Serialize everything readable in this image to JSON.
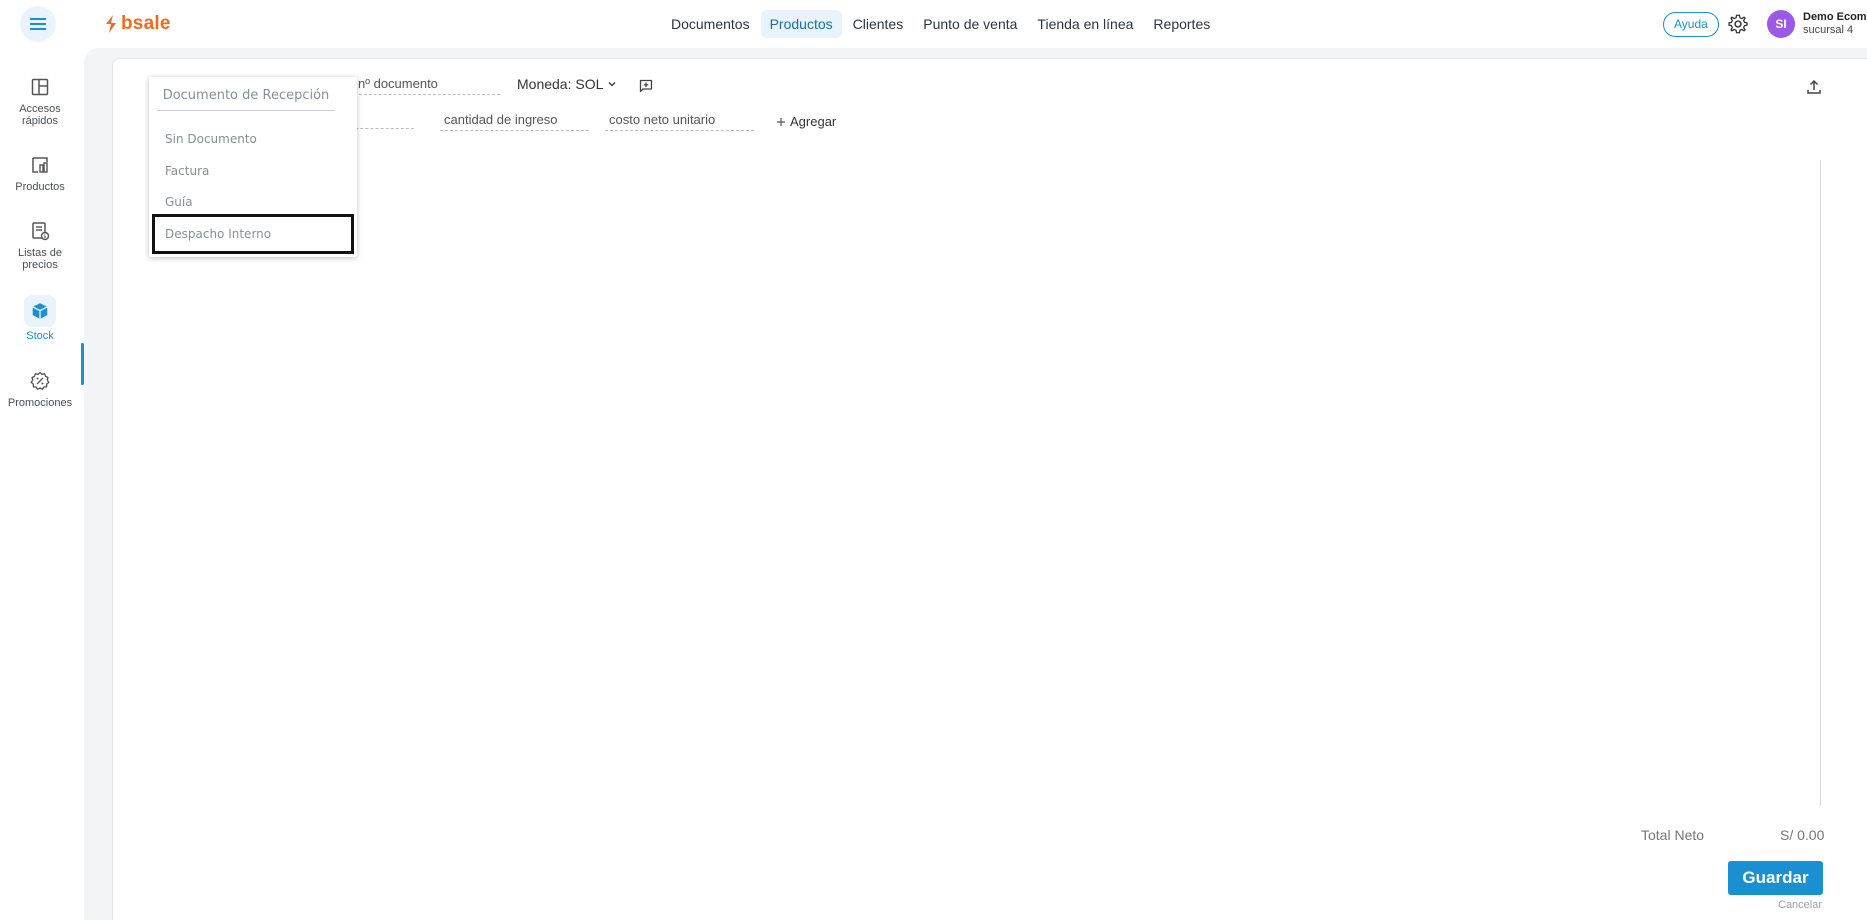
{
  "header": {
    "logo_text": "bsale",
    "nav": [
      {
        "label": "Documentos",
        "active": false
      },
      {
        "label": "Productos",
        "active": true
      },
      {
        "label": "Clientes",
        "active": false
      },
      {
        "label": "Punto de venta",
        "active": false
      },
      {
        "label": "Tienda en línea",
        "active": false
      },
      {
        "label": "Reportes",
        "active": false
      }
    ],
    "help_label": "Ayuda",
    "avatar_initials": "SI",
    "user_name": "Demo Ecom",
    "user_branch": "sucursal 4"
  },
  "sidebar": {
    "items": [
      {
        "label_line1": "Accesos",
        "label_line2": "rápidos",
        "icon": "quick-access-icon"
      },
      {
        "label_line1": "Productos",
        "label_line2": "",
        "icon": "products-icon"
      },
      {
        "label_line1": "Listas de",
        "label_line2": "precios",
        "icon": "price-list-icon"
      },
      {
        "label_line1": "Stock",
        "label_line2": "",
        "icon": "stock-box-icon",
        "active": true
      },
      {
        "label_line1": "Promociones",
        "label_line2": "",
        "icon": "promotions-icon"
      }
    ]
  },
  "form": {
    "doc_number_placeholder": "nº documento",
    "currency_label": "Moneda: SOL",
    "quantity_placeholder": "cantidad de ingreso",
    "unit_cost_placeholder": "costo neto unitario",
    "add_label": "Agregar"
  },
  "dropdown": {
    "header": "Documento de Recepción",
    "options": [
      "Sin Documento",
      "Factura",
      "Guía",
      "Despacho Interno"
    ],
    "highlighted": "Despacho Interno"
  },
  "footer": {
    "total_label": "Total Neto",
    "total_value": "S/ 0.00",
    "save_label": "Guardar",
    "cancel_label": "Cancelar"
  },
  "colors": {
    "accent": "#1a8fd1",
    "brand": "#f26b1d",
    "avatar": "#9b59e6"
  }
}
